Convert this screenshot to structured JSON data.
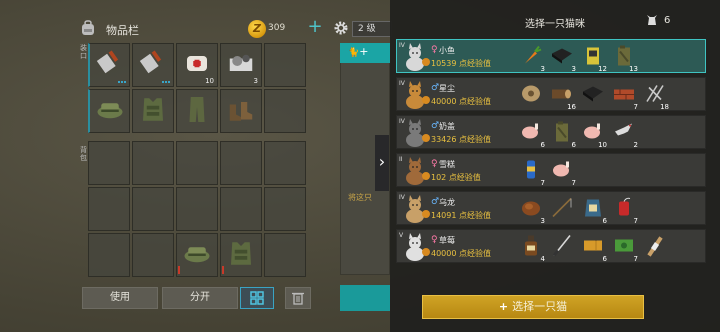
{
  "inventory": {
    "title": "物品栏",
    "coins": "309",
    "coin_symbol": "Z",
    "side_label_top": "装口",
    "side_label_bottom": "背包",
    "top_cells": [
      {
        "icon": "cleaver-icon",
        "qty": "",
        "dots": true
      },
      {
        "icon": "cleaver-icon",
        "qty": "",
        "dots": true
      },
      {
        "icon": "bandage-icon",
        "qty": "10"
      },
      {
        "icon": "cable-tape-icon",
        "qty": "3"
      },
      {
        "icon": "",
        "qty": ""
      },
      {
        "icon": "military-cap-icon",
        "qty": ""
      },
      {
        "icon": "armor-vest-icon",
        "qty": ""
      },
      {
        "icon": "pants-icon",
        "qty": ""
      },
      {
        "icon": "boots-icon",
        "qty": ""
      },
      {
        "icon": "",
        "qty": ""
      }
    ],
    "bottom_cells": [
      {
        "icon": ""
      },
      {
        "icon": ""
      },
      {
        "icon": ""
      },
      {
        "icon": ""
      },
      {
        "icon": ""
      },
      {
        "icon": ""
      },
      {
        "icon": ""
      },
      {
        "icon": ""
      },
      {
        "icon": ""
      },
      {
        "icon": ""
      },
      {
        "icon": ""
      },
      {
        "icon": ""
      },
      {
        "icon": "military-cap-icon",
        "red": true
      },
      {
        "icon": "armor-vest-icon",
        "red": true
      },
      {
        "icon": ""
      }
    ],
    "use_label": "使用",
    "split_label": "分开"
  },
  "middle": {
    "level_label": "2 级",
    "tab_symbol": "+",
    "hint_text": "将这只"
  },
  "cats": {
    "title": "选择一只猫咪",
    "count": "6",
    "list": [
      {
        "rank": "IV",
        "sex": "♀",
        "sex_class": "f",
        "name": "小鱼",
        "xp": "10539 点经验值",
        "color": "#d8d8d8",
        "selected": true,
        "items": [
          {
            "icon": "carrot-icon",
            "q": "3"
          },
          {
            "icon": "black-cloth-icon",
            "q": "3"
          },
          {
            "icon": "battery-device-icon",
            "q": "12"
          },
          {
            "icon": "jerrycan-icon",
            "q": "13"
          }
        ]
      },
      {
        "rank": "IV",
        "sex": "♂",
        "sex_class": "m",
        "name": "星尘",
        "xp": "40000 点经验值",
        "color": "#c88a3a",
        "items": [
          {
            "icon": "rope-spool-icon",
            "q": ""
          },
          {
            "icon": "wood-log-icon",
            "q": "16"
          },
          {
            "icon": "black-cloth-icon",
            "q": ""
          },
          {
            "icon": "brick-icon",
            "q": "7"
          },
          {
            "icon": "nails-icon",
            "q": "18"
          }
        ]
      },
      {
        "rank": "IV",
        "sex": "♂",
        "sex_class": "m",
        "name": "奶盖",
        "xp": "33426 点经验值",
        "color": "#7a7a7a",
        "items": [
          {
            "icon": "raw-chicken-icon",
            "q": "6"
          },
          {
            "icon": "jerrycan-icon",
            "q": "6"
          },
          {
            "icon": "raw-chicken-icon",
            "q": "10"
          },
          {
            "icon": "bird-icon",
            "q": "2"
          }
        ]
      },
      {
        "rank": "II",
        "sex": "♀",
        "sex_class": "f",
        "name": "雪糕",
        "xp": "102 点经验值",
        "color": "#a06a3a",
        "items": [
          {
            "icon": "soda-can-icon",
            "q": "7"
          },
          {
            "icon": "raw-chicken-icon",
            "q": "7"
          }
        ]
      },
      {
        "rank": "IV",
        "sex": "♂",
        "sex_class": "m",
        "name": "乌龙",
        "xp": "14091 点经验值",
        "color": "#c8a068",
        "items": [
          {
            "icon": "roasted-meat-icon",
            "q": "3"
          },
          {
            "icon": "fishing-rod-icon",
            "q": ""
          },
          {
            "icon": "seed-bag-icon",
            "q": "6"
          },
          {
            "icon": "dynamite-icon",
            "q": "7"
          }
        ]
      },
      {
        "rank": "V",
        "sex": "♀",
        "sex_class": "f",
        "name": "草莓",
        "xp": "40000 点经验值",
        "color": "#e0e0e0",
        "items": [
          {
            "icon": "whiskey-bottle-icon",
            "q": "4"
          },
          {
            "icon": "katana-icon",
            "q": ""
          },
          {
            "icon": "ticket-icon",
            "q": "6"
          },
          {
            "icon": "cash-icon",
            "q": "7"
          },
          {
            "icon": "bandaged-stick-icon",
            "q": ""
          }
        ]
      }
    ],
    "confirm_label": "选择一只猫",
    "confirm_symbol": "+"
  }
}
